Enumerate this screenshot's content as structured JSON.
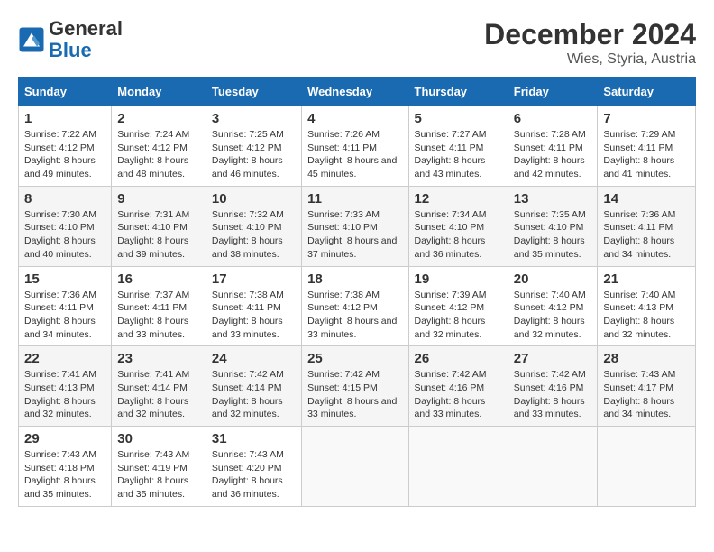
{
  "logo": {
    "text_general": "General",
    "text_blue": "Blue"
  },
  "title": "December 2024",
  "subtitle": "Wies, Styria, Austria",
  "days_of_week": [
    "Sunday",
    "Monday",
    "Tuesday",
    "Wednesday",
    "Thursday",
    "Friday",
    "Saturday"
  ],
  "weeks": [
    [
      {
        "day": "1",
        "sunrise": "7:22 AM",
        "sunset": "4:12 PM",
        "daylight": "8 hours and 49 minutes."
      },
      {
        "day": "2",
        "sunrise": "7:24 AM",
        "sunset": "4:12 PM",
        "daylight": "8 hours and 48 minutes."
      },
      {
        "day": "3",
        "sunrise": "7:25 AM",
        "sunset": "4:12 PM",
        "daylight": "8 hours and 46 minutes."
      },
      {
        "day": "4",
        "sunrise": "7:26 AM",
        "sunset": "4:11 PM",
        "daylight": "8 hours and 45 minutes."
      },
      {
        "day": "5",
        "sunrise": "7:27 AM",
        "sunset": "4:11 PM",
        "daylight": "8 hours and 43 minutes."
      },
      {
        "day": "6",
        "sunrise": "7:28 AM",
        "sunset": "4:11 PM",
        "daylight": "8 hours and 42 minutes."
      },
      {
        "day": "7",
        "sunrise": "7:29 AM",
        "sunset": "4:11 PM",
        "daylight": "8 hours and 41 minutes."
      }
    ],
    [
      {
        "day": "8",
        "sunrise": "7:30 AM",
        "sunset": "4:10 PM",
        "daylight": "8 hours and 40 minutes."
      },
      {
        "day": "9",
        "sunrise": "7:31 AM",
        "sunset": "4:10 PM",
        "daylight": "8 hours and 39 minutes."
      },
      {
        "day": "10",
        "sunrise": "7:32 AM",
        "sunset": "4:10 PM",
        "daylight": "8 hours and 38 minutes."
      },
      {
        "day": "11",
        "sunrise": "7:33 AM",
        "sunset": "4:10 PM",
        "daylight": "8 hours and 37 minutes."
      },
      {
        "day": "12",
        "sunrise": "7:34 AM",
        "sunset": "4:10 PM",
        "daylight": "8 hours and 36 minutes."
      },
      {
        "day": "13",
        "sunrise": "7:35 AM",
        "sunset": "4:10 PM",
        "daylight": "8 hours and 35 minutes."
      },
      {
        "day": "14",
        "sunrise": "7:36 AM",
        "sunset": "4:11 PM",
        "daylight": "8 hours and 34 minutes."
      }
    ],
    [
      {
        "day": "15",
        "sunrise": "7:36 AM",
        "sunset": "4:11 PM",
        "daylight": "8 hours and 34 minutes."
      },
      {
        "day": "16",
        "sunrise": "7:37 AM",
        "sunset": "4:11 PM",
        "daylight": "8 hours and 33 minutes."
      },
      {
        "day": "17",
        "sunrise": "7:38 AM",
        "sunset": "4:11 PM",
        "daylight": "8 hours and 33 minutes."
      },
      {
        "day": "18",
        "sunrise": "7:38 AM",
        "sunset": "4:12 PM",
        "daylight": "8 hours and 33 minutes."
      },
      {
        "day": "19",
        "sunrise": "7:39 AM",
        "sunset": "4:12 PM",
        "daylight": "8 hours and 32 minutes."
      },
      {
        "day": "20",
        "sunrise": "7:40 AM",
        "sunset": "4:12 PM",
        "daylight": "8 hours and 32 minutes."
      },
      {
        "day": "21",
        "sunrise": "7:40 AM",
        "sunset": "4:13 PM",
        "daylight": "8 hours and 32 minutes."
      }
    ],
    [
      {
        "day": "22",
        "sunrise": "7:41 AM",
        "sunset": "4:13 PM",
        "daylight": "8 hours and 32 minutes."
      },
      {
        "day": "23",
        "sunrise": "7:41 AM",
        "sunset": "4:14 PM",
        "daylight": "8 hours and 32 minutes."
      },
      {
        "day": "24",
        "sunrise": "7:42 AM",
        "sunset": "4:14 PM",
        "daylight": "8 hours and 32 minutes."
      },
      {
        "day": "25",
        "sunrise": "7:42 AM",
        "sunset": "4:15 PM",
        "daylight": "8 hours and 33 minutes."
      },
      {
        "day": "26",
        "sunrise": "7:42 AM",
        "sunset": "4:16 PM",
        "daylight": "8 hours and 33 minutes."
      },
      {
        "day": "27",
        "sunrise": "7:42 AM",
        "sunset": "4:16 PM",
        "daylight": "8 hours and 33 minutes."
      },
      {
        "day": "28",
        "sunrise": "7:43 AM",
        "sunset": "4:17 PM",
        "daylight": "8 hours and 34 minutes."
      }
    ],
    [
      {
        "day": "29",
        "sunrise": "7:43 AM",
        "sunset": "4:18 PM",
        "daylight": "8 hours and 35 minutes."
      },
      {
        "day": "30",
        "sunrise": "7:43 AM",
        "sunset": "4:19 PM",
        "daylight": "8 hours and 35 minutes."
      },
      {
        "day": "31",
        "sunrise": "7:43 AM",
        "sunset": "4:20 PM",
        "daylight": "8 hours and 36 minutes."
      },
      null,
      null,
      null,
      null
    ]
  ],
  "labels": {
    "sunrise": "Sunrise:",
    "sunset": "Sunset:",
    "daylight": "Daylight:"
  }
}
